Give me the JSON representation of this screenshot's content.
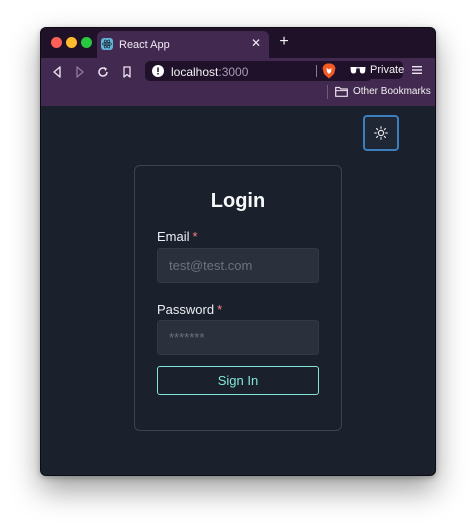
{
  "browser": {
    "tab": {
      "title": "React App",
      "favicon": "react-logo-icon"
    },
    "new_tab_label": "+",
    "tab_close_label": "✕",
    "url": {
      "host": "localhost",
      "port": ":3000"
    },
    "private_label": "Private",
    "bookmarks_label": "Other Bookmarks",
    "colors": {
      "tabbar": "#1f1127",
      "toolbar": "#42294f",
      "urlbar": "#20112a"
    }
  },
  "page": {
    "theme_toggle_icon": "sun-icon",
    "login": {
      "title": "Login",
      "email_label": "Email",
      "email_placeholder": "test@test.com",
      "email_value": "",
      "password_label": "Password",
      "password_placeholder": "*******",
      "password_value": "",
      "required_marker": "*",
      "submit_label": "Sign In"
    },
    "colors": {
      "background": "#1a202c",
      "accent": "#81e6d9",
      "required": "#fc8181",
      "toggle_border": "#3c7fbf"
    }
  }
}
